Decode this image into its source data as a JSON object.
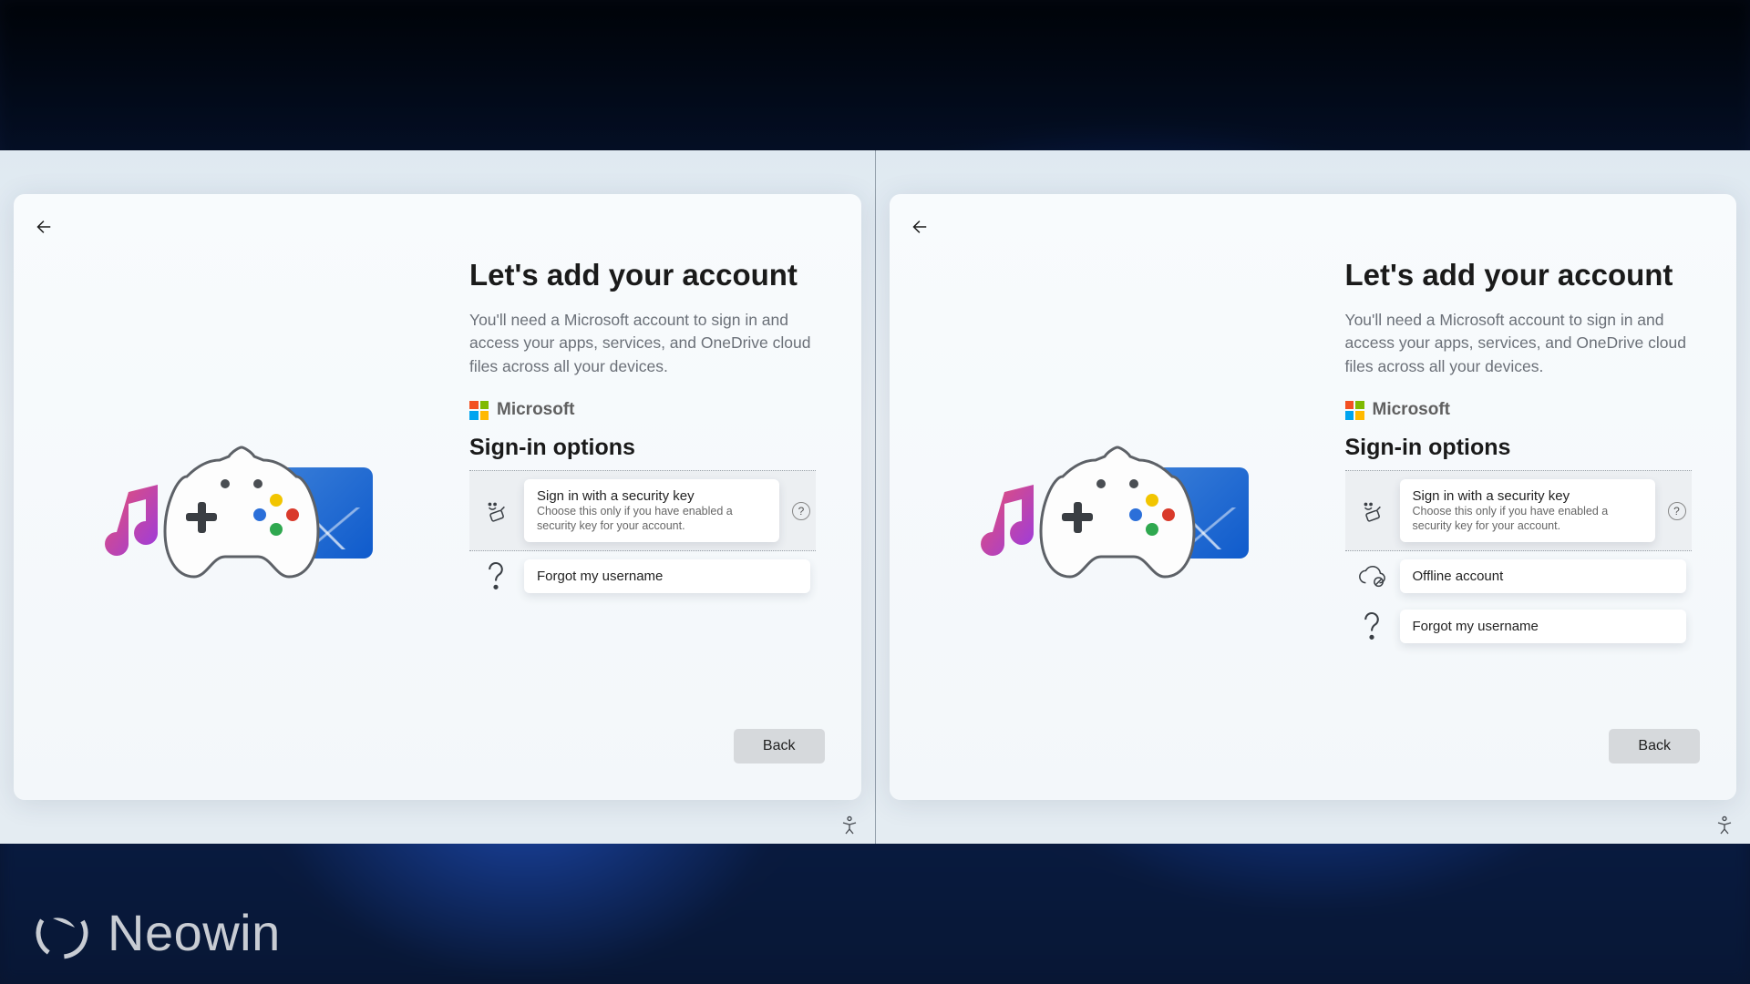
{
  "common": {
    "heading": "Let's add your account",
    "subtext": "You'll need a Microsoft account to sign in and access your apps, services, and OneDrive cloud files across all your devices.",
    "ms_brand": "Microsoft",
    "section_title": "Sign-in options",
    "back_button": "Back",
    "security_key_title": "Sign in with a security key",
    "security_key_sub": "Choose this only if you have enabled a security key for your account.",
    "offline_account": "Offline account",
    "forgot_username": "Forgot my username",
    "help_glyph": "?"
  },
  "watermark": {
    "text": "Neowin"
  }
}
